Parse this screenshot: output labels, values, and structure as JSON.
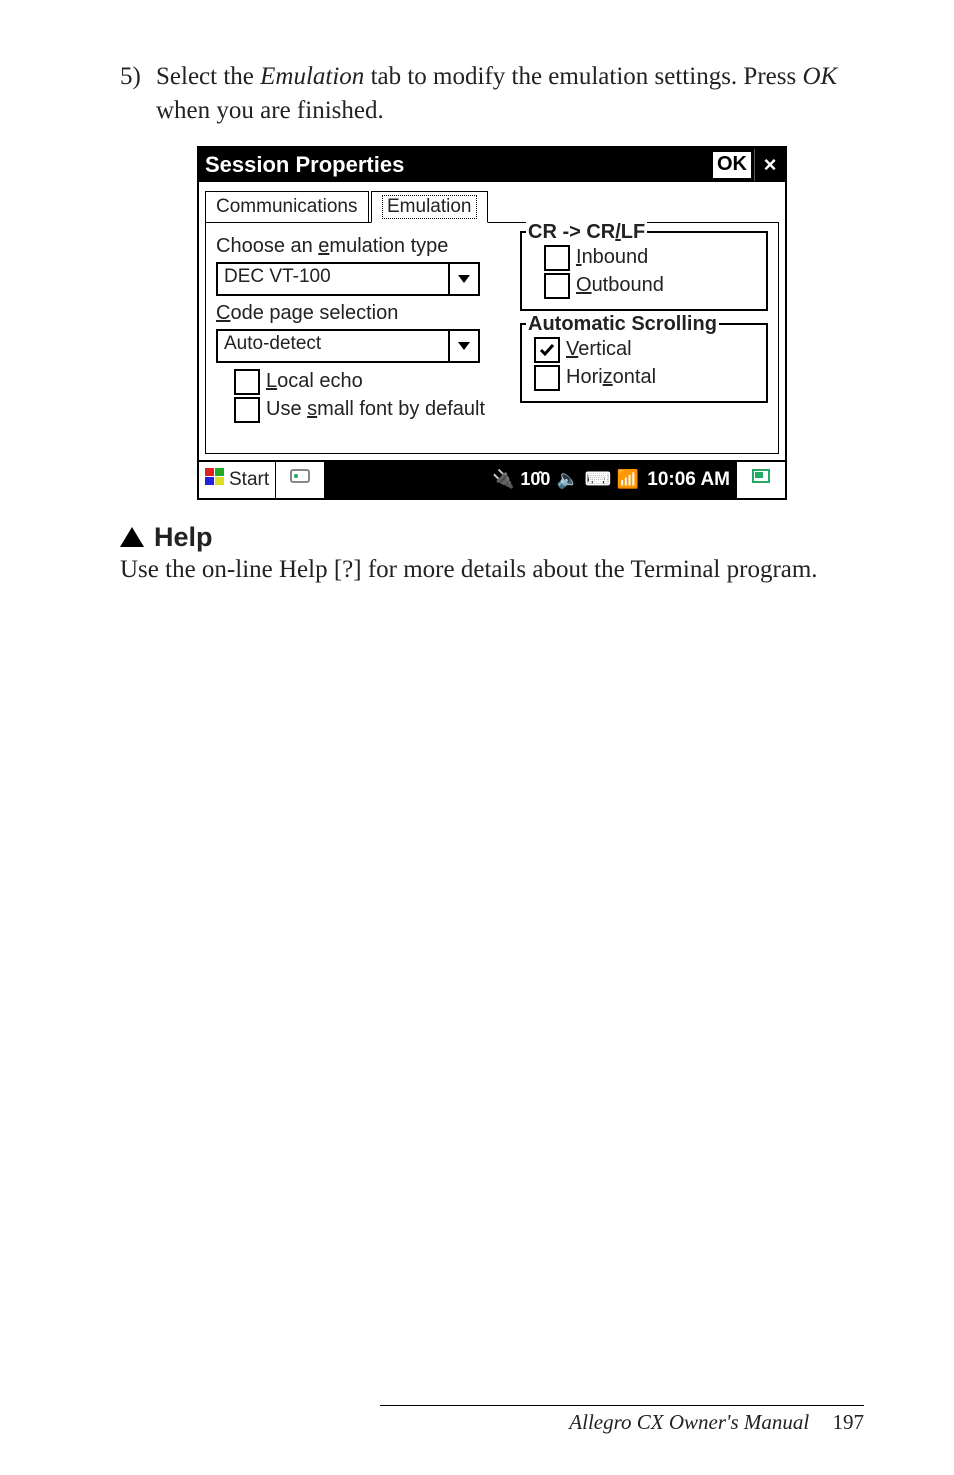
{
  "intro": {
    "number": "5)",
    "pre": "Select the ",
    "em": "Emulation",
    "mid": " tab to modify the emulation settings. Press ",
    "em2": "OK",
    "post": " when you are finished."
  },
  "window": {
    "title": "Session Properties",
    "ok": "OK",
    "close": "×",
    "tabs": {
      "communications": "Communications",
      "emulation": "Emulation"
    },
    "labels": {
      "choose": "Choose an emulation type",
      "choose_u": "e",
      "code": "Code page selection",
      "code_u": "C",
      "emulation_value": "DEC VT-100",
      "codepage_value": "Auto-detect",
      "localecho": "Local echo",
      "localecho_u": "L",
      "smallfont": "Use small font by default",
      "smallfont_u": "s"
    },
    "crlf": {
      "legend": "CR -> CR/LF",
      "legend_u": "/",
      "inbound": "Inbound",
      "inbound_u": "I",
      "outbound": "Outbound",
      "outbound_u": "O"
    },
    "scroll": {
      "legend": "Automatic Scrolling",
      "vertical": "Vertical",
      "vertical_u": "V",
      "horizontal": "Horizontal",
      "horizontal_u": "z"
    },
    "taskbar": {
      "start": "Start",
      "time": "10:06 AM"
    }
  },
  "help": {
    "heading": "Help",
    "body": "Use the on-line Help [?] for more details about the Terminal program."
  },
  "footer": {
    "book": "Allegro CX Owner's Manual",
    "page": "197"
  }
}
